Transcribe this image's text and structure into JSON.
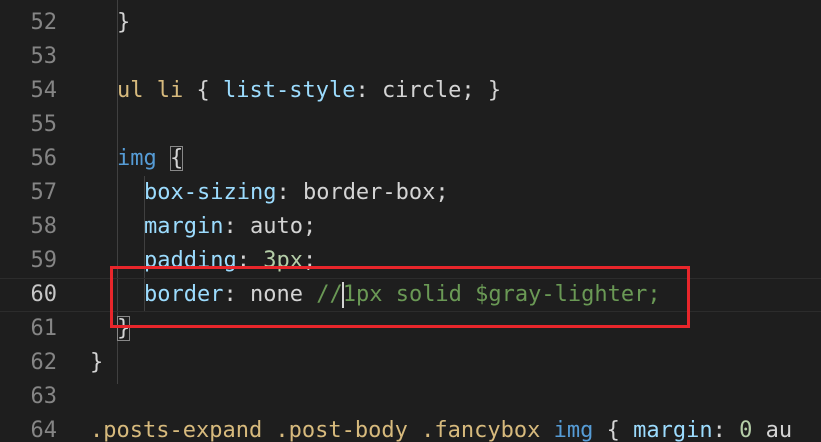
{
  "editor": {
    "lines": [
      {
        "number": "52",
        "tokens": [
          {
            "t": "}",
            "c": "pun"
          }
        ]
      },
      {
        "number": "53",
        "tokens": []
      },
      {
        "number": "54",
        "tokens": [
          {
            "t": "ul li",
            "c": "tag"
          },
          {
            "t": " { ",
            "c": "pun"
          },
          {
            "t": "list-style",
            "c": "prop"
          },
          {
            "t": ": ",
            "c": "pun"
          },
          {
            "t": "circle",
            "c": "val"
          },
          {
            "t": "; }",
            "c": "pun"
          }
        ]
      },
      {
        "number": "55",
        "tokens": []
      },
      {
        "number": "56",
        "tokens": [
          {
            "t": "img",
            "c": "sel"
          },
          {
            "t": " ",
            "c": "pun"
          },
          {
            "t": "{",
            "c": "pun bracket-match"
          }
        ]
      },
      {
        "number": "57",
        "tokens": [
          {
            "t": "box-sizing",
            "c": "prop"
          },
          {
            "t": ": ",
            "c": "pun"
          },
          {
            "t": "border-box",
            "c": "val"
          },
          {
            "t": ";",
            "c": "pun"
          }
        ]
      },
      {
        "number": "58",
        "tokens": [
          {
            "t": "margin",
            "c": "prop"
          },
          {
            "t": ": ",
            "c": "pun"
          },
          {
            "t": "auto",
            "c": "val"
          },
          {
            "t": ";",
            "c": "pun"
          }
        ]
      },
      {
        "number": "59",
        "tokens": [
          {
            "t": "padding",
            "c": "prop"
          },
          {
            "t": ": ",
            "c": "pun"
          },
          {
            "t": "3px",
            "c": "num"
          },
          {
            "t": ";",
            "c": "pun"
          }
        ]
      },
      {
        "number": "60",
        "tokens": [
          {
            "t": "border",
            "c": "prop"
          },
          {
            "t": ": ",
            "c": "pun"
          },
          {
            "t": "none ",
            "c": "val"
          },
          {
            "t": "//",
            "c": "cmt"
          },
          {
            "t": "",
            "c": "cursor"
          },
          {
            "t": "1px solid $gray-lighter;",
            "c": "cmt"
          }
        ]
      },
      {
        "number": "61",
        "tokens": [
          {
            "t": "}",
            "c": "pun bracket-match"
          }
        ]
      },
      {
        "number": "62",
        "tokens": [
          {
            "t": "}",
            "c": "pun"
          }
        ]
      },
      {
        "number": "63",
        "tokens": []
      },
      {
        "number": "64",
        "tokens": [
          {
            "t": ".posts-expand .post-body .fancybox",
            "c": "cls"
          },
          {
            "t": " ",
            "c": "pun"
          },
          {
            "t": "img",
            "c": "sel"
          },
          {
            "t": " { ",
            "c": "pun"
          },
          {
            "t": "margin",
            "c": "prop"
          },
          {
            "t": ": ",
            "c": "pun"
          },
          {
            "t": "0",
            "c": "num"
          },
          {
            "t": " au",
            "c": "val"
          }
        ]
      }
    ]
  }
}
